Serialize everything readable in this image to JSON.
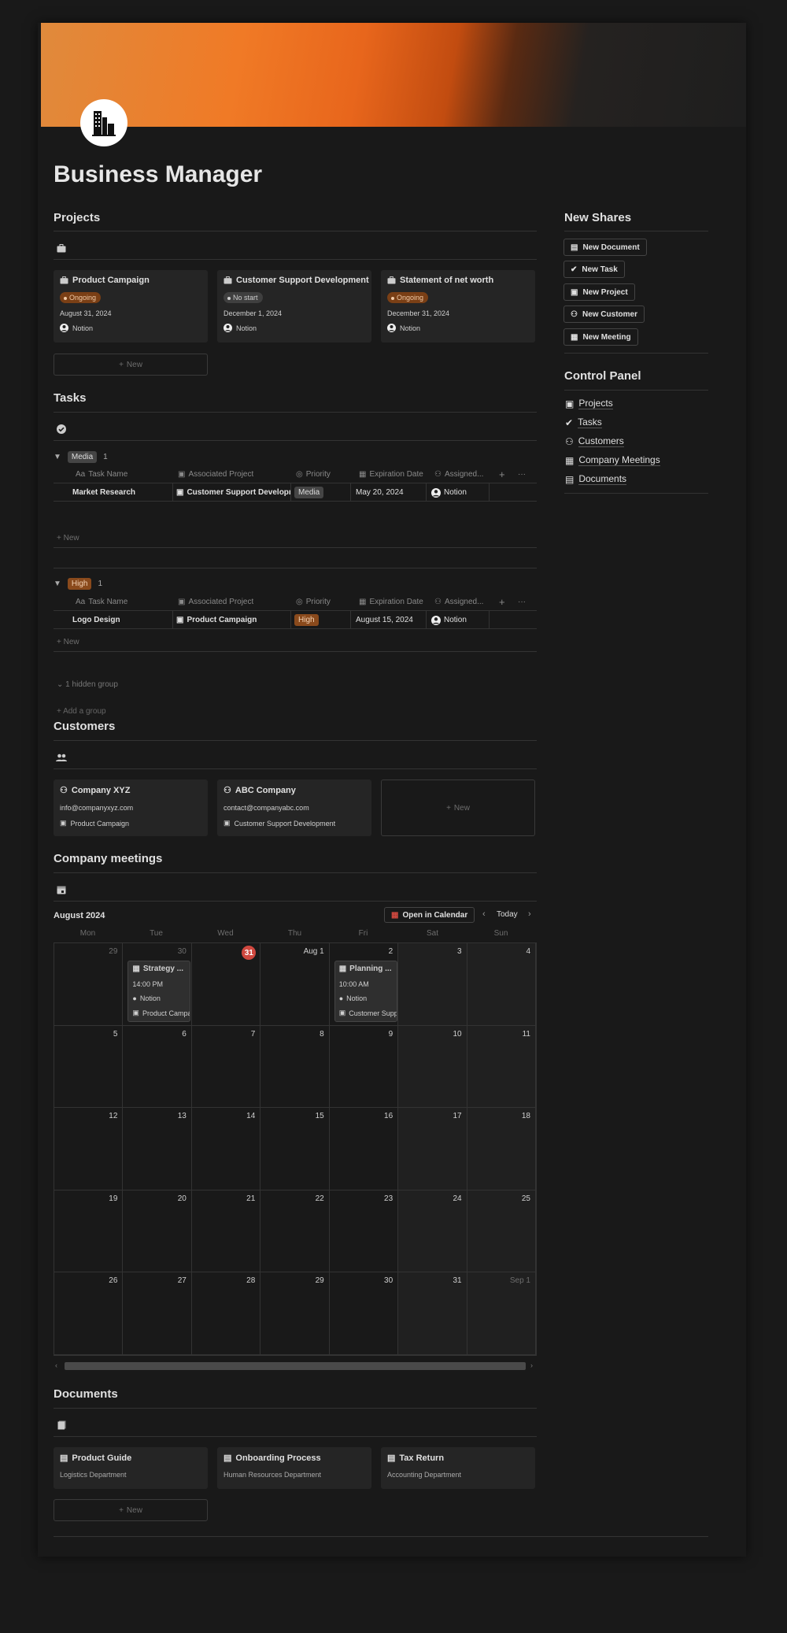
{
  "page_title": "Business Manager",
  "projects": {
    "title": "Projects",
    "cards": [
      {
        "name": "Product Campaign",
        "status": "Ongoing",
        "date": "August 31, 2024",
        "owner": "Notion"
      },
      {
        "name": "Customer Support Development",
        "status": "No start",
        "date": "December 1, 2024",
        "owner": "Notion"
      },
      {
        "name": "Statement of net worth",
        "status": "Ongoing",
        "date": "December 31, 2024",
        "owner": "Notion"
      }
    ],
    "new_label": "New"
  },
  "tasks": {
    "title": "Tasks",
    "columns": [
      "Task Name",
      "Associated Project",
      "Priority",
      "Expiration Date",
      "Assigned..."
    ],
    "groups": [
      {
        "tag": "Media",
        "count": "1",
        "rows": [
          {
            "task": "Market Research",
            "project": "Customer Support Development",
            "priority": "Media",
            "date": "May 20, 2024",
            "assigned": "Notion"
          }
        ]
      },
      {
        "tag": "High",
        "count": "1",
        "rows": [
          {
            "task": "Logo Design",
            "project": "Product Campaign",
            "priority": "High",
            "date": "August 15, 2024",
            "assigned": "Notion"
          }
        ]
      }
    ],
    "new_label": "New",
    "hidden_group": "1 hidden group",
    "add_group": "Add a group"
  },
  "customers": {
    "title": "Customers",
    "cards": [
      {
        "name": "Company XYZ",
        "email": "info@companyxyz.com",
        "project": "Product Campaign"
      },
      {
        "name": "ABC Company",
        "email": "contact@companyabc.com",
        "project": "Customer Support Development"
      }
    ],
    "new_label": "New"
  },
  "meetings": {
    "title": "Company meetings",
    "month": "August 2024",
    "open_calendar": "Open in Calendar",
    "today": "Today",
    "weekdays": [
      "Mon",
      "Tue",
      "Wed",
      "Thu",
      "Fri",
      "Sat",
      "Sun"
    ],
    "days": [
      "29",
      "30",
      "31",
      "Aug 1",
      "2",
      "3",
      "4",
      "5",
      "6",
      "7",
      "8",
      "9",
      "10",
      "11",
      "12",
      "13",
      "14",
      "15",
      "16",
      "17",
      "18",
      "19",
      "20",
      "21",
      "22",
      "23",
      "24",
      "25",
      "26",
      "27",
      "28",
      "29",
      "30",
      "31",
      "Sep 1"
    ],
    "events": [
      {
        "title": "Strategy ...",
        "time": "14:00 PM",
        "owner": "Notion",
        "project": "Product Campaign"
      },
      {
        "title": "Planning ...",
        "time": "10:00 AM",
        "owner": "Notion",
        "project": "Customer Support Development"
      }
    ]
  },
  "documents": {
    "title": "Documents",
    "cards": [
      {
        "name": "Product Guide",
        "dept": "Logistics Department"
      },
      {
        "name": "Onboarding Process",
        "dept": "Human Resources Department"
      },
      {
        "name": "Tax Return",
        "dept": "Accounting Department"
      }
    ],
    "new_label": "New"
  },
  "new_shares": {
    "title": "New Shares",
    "buttons": [
      "New Document",
      "New Task",
      "New Project",
      "New Customer",
      "New Meeting"
    ]
  },
  "control_panel": {
    "title": "Control Panel",
    "items": [
      "Projects",
      "Tasks",
      "Customers",
      "Company Meetings",
      "Documents"
    ]
  },
  "colors": {
    "accent": "#f07a26",
    "today": "#d0483f",
    "ongoing": "#7a3f15",
    "high": "#8a4a1c"
  }
}
